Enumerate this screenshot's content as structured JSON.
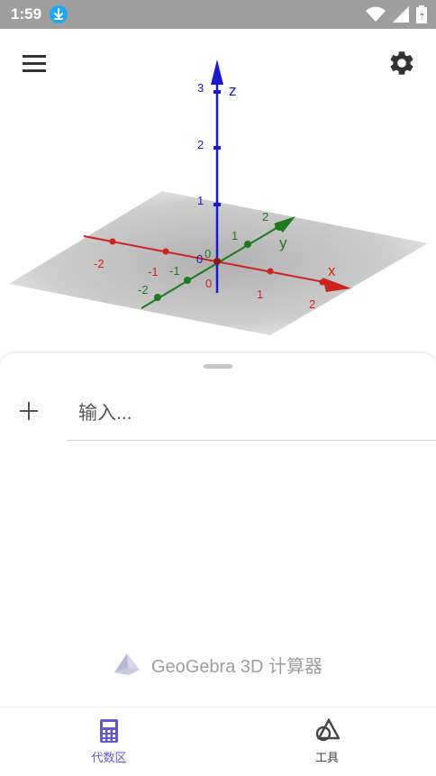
{
  "status_bar": {
    "time": "1:59"
  },
  "graphics": {
    "axis_labels": {
      "x": "x",
      "y": "y",
      "z": "z"
    },
    "z_ticks": [
      "1",
      "2",
      "3"
    ],
    "x_ticks_positive": [
      "1",
      "2"
    ],
    "x_ticks_negative": [
      "-1",
      "-2"
    ],
    "y_ticks_positive": [
      "1",
      "2"
    ],
    "y_ticks_negative": [
      "-1",
      "-2"
    ],
    "origin_labels": [
      "0",
      "0",
      "0"
    ],
    "colors": {
      "x_axis": "#cc2222",
      "y_axis": "#1f7a1f",
      "z_axis": "#1a1acc"
    }
  },
  "algebra": {
    "input_placeholder": "输入..."
  },
  "branding": {
    "text": "GeoGebra 3D 计算器"
  },
  "bottom_nav": {
    "tabs": [
      {
        "label": "代数区",
        "icon": "calculator-icon",
        "active": true
      },
      {
        "label": "工具",
        "icon": "geometry-tools-icon",
        "active": false
      }
    ],
    "accent": "#6557d2"
  }
}
